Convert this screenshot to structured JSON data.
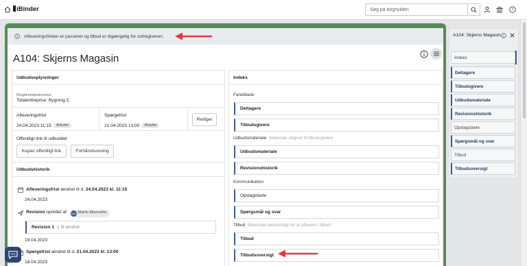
{
  "topbar": {
    "logo_text": "iBinder",
    "search_placeholder": "Søg på boghylden",
    "icons": [
      "home-icon",
      "search-icon",
      "user-icon",
      "bank-icon",
      "help-icon"
    ]
  },
  "notice": {
    "text": "Afleveringsfristen er passeret og tilbud er tilgængelig for ordregiveren."
  },
  "page": {
    "title": "A104: Skjerns Magasin"
  },
  "udbud": {
    "heading": "Udbudsoplysninger",
    "ringbind_label": "Ringbindsbeskrivelse",
    "ringbind_value": "Totalentreprise: Bygning C",
    "aflevering_label": "Afleveringsfrist",
    "aflevering_value": "24.04.2023 11:15",
    "aflevering_badge": "Afsluttet",
    "sporge_label": "Spørgefrist",
    "sporge_value": "21.04.2023 13:00",
    "sporge_badge": "Afsluttet",
    "edit_button": "Rediger",
    "public_link_label": "Offentligt link til udbuddet",
    "copy_button": "Kopier offentligt link",
    "preview_button": "Forhåndsvisning"
  },
  "history": {
    "heading": "Udbudshistorik",
    "entry1_field": "Afleveringsfrist",
    "entry1_mid": " ændret til d. ",
    "entry1_value": "24.04.2023 kl. 11:15",
    "entry1_date": "24.04.2023",
    "entry2_field": "Revision",
    "entry2_mid": " oprettet af ",
    "entry2_initials": "MM",
    "entry2_person": "Martin Meersohn",
    "rev_title": "Revision 1",
    "rev_sub": "1 fil ændret",
    "entry2_date": "19.04.2023",
    "entry3_field": "Spørgefrist",
    "entry3_mid": " ændret til d. ",
    "entry3_value": "21.04.2023 kl. 13:00",
    "entry3_date": "18.04.2023"
  },
  "indeks": {
    "heading": "Indeks",
    "group1": "Faneblade",
    "group1_items": [
      "Deltagere",
      "Tilbudsgivere"
    ],
    "group2": "Udbudsmateriale",
    "group2_sub": "Materiale udgivet til tilbudsgivere",
    "group2_items": [
      "Udbudsmateriale",
      "Revisionshistorik"
    ],
    "group3": "Kommunikation",
    "group3_items": [
      "Opslagstavle",
      "Spørgsmål og svar"
    ],
    "group4": "Tilbud",
    "group4_sub": "Materiale nødvendigt for at aflevere i tilbud",
    "group4_items": [
      "Tilbud",
      "Tilbudsoversigt"
    ]
  },
  "side": {
    "title": "A104: Skjerns Magasin",
    "items": [
      "Indeks",
      "Deltagere",
      "Tilbudsgivere",
      "Udbudsmateriale",
      "Revisionshistorik",
      "Opslagstavle",
      "Spørgsmål og svar",
      "Tilbud",
      "Tilbudsoversigt"
    ]
  },
  "colors": {
    "frame": "#5a8a5a",
    "accent": "#3e5a8a",
    "arrow": "#e03a3a"
  }
}
